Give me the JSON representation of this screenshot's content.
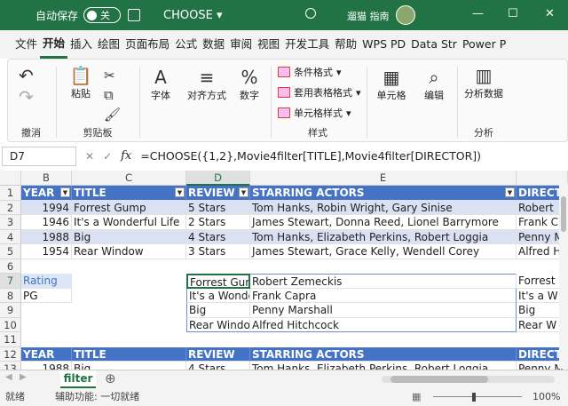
{
  "titlebar": {
    "autosave_label": "自动保存",
    "autosave_state": "关",
    "file_name": "CHOOSE",
    "user_name": "遛猫 指南",
    "min": "—",
    "restore": "☐",
    "close": "✕"
  },
  "tabs": [
    "文件",
    "开始",
    "插入",
    "绘图",
    "页面布局",
    "公式",
    "数据",
    "审阅",
    "视图",
    "开发工具",
    "帮助",
    "WPS PD",
    "Data Str",
    "Power P"
  ],
  "ribbon": {
    "undo_group": "撤消",
    "clipboard": {
      "paste": "粘贴",
      "group": "剪贴板"
    },
    "font": {
      "label": "字体"
    },
    "align": {
      "label": "对齐方式"
    },
    "number": {
      "label": "数字"
    },
    "styles": {
      "cond": "条件格式",
      "table": "套用表格格式",
      "cell": "单元格样式",
      "group": "样式"
    },
    "cells": {
      "label": "单元格"
    },
    "edit": {
      "label": "编辑"
    },
    "analysis": {
      "label": "分析数据",
      "group": "分析"
    }
  },
  "formula_bar": {
    "name_box": "D7",
    "fx": "fx",
    "formula": "=CHOOSE({1,2},Movie4filter[TITLE],Movie4filter[DIRECTOR])"
  },
  "columns": [
    "B",
    "C",
    "D",
    "E"
  ],
  "rows": [
    "1",
    "2",
    "3",
    "4",
    "5",
    "6",
    "7",
    "8",
    "9",
    "10",
    "11",
    "12",
    "13"
  ],
  "table_header": [
    "YEAR",
    "TITLE",
    "REVIEW",
    "STARRING ACTORS",
    "DIRECT"
  ],
  "table_rows": [
    [
      "1994",
      "Forrest Gump",
      "5 Stars",
      "Tom Hanks, Robin Wright, Gary Sinise",
      "Robert"
    ],
    [
      "1946",
      "It's a Wonderful Life",
      "2 Stars",
      "James Stewart, Donna Reed, Lionel Barrymore",
      "Frank C"
    ],
    [
      "1988",
      "Big",
      "4 Stars",
      "Tom Hanks, Elizabeth Perkins, Robert Loggia",
      "Penny M"
    ],
    [
      "1954",
      "Rear Window",
      "3 Stars",
      "James Stewart, Grace Kelly, Wendell Corey",
      "Alfred H"
    ]
  ],
  "rating_label": "Rating",
  "rating_value": "PG",
  "spill_rows": [
    [
      "Forrest Gump",
      "Robert Zemeckis",
      "Forrest"
    ],
    [
      "It's a Wonderful Life",
      "Frank Capra",
      "It's a W"
    ],
    [
      "Big",
      "Penny Marshall",
      "Big"
    ],
    [
      "Rear Window",
      "Alfred Hitchcock",
      "Rear W"
    ]
  ],
  "second_header": [
    "YEAR",
    "TITLE",
    "REVIEW",
    "STARRING ACTORS",
    "DIRECT"
  ],
  "second_row": [
    "1988",
    "Big",
    "4 Stars",
    "Tom Hanks, Elizabeth Perkins, Robert Loggia",
    "Penny M"
  ],
  "sheet_tab": "filter",
  "status": {
    "ready": "就绪",
    "accessibility": "辅助功能: 一切就绪",
    "zoom": "100%"
  },
  "colors": {
    "excel_green": "#217346",
    "table_header_blue": "#4472c4",
    "band": "#d9e1f2"
  }
}
